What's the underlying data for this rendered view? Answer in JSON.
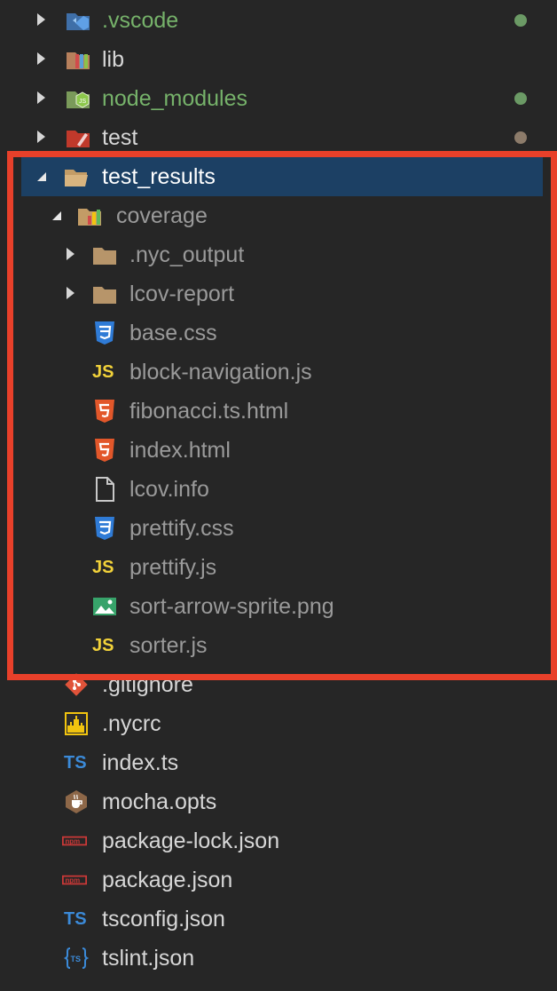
{
  "explorer": {
    "colors": {
      "background": "#262626",
      "selection": "#1c4064",
      "highlight_border": "#e8402a",
      "modified_dot": "#6b9a65",
      "untracked_dot": "#8c7b6a",
      "green_text": "#76b26a",
      "dim_text": "#9a9a9a",
      "light_text": "#d7d7d7"
    },
    "items": [
      {
        "label": ".vscode",
        "icon": "vscode-folder-icon"
      },
      {
        "label": "lib",
        "icon": "lib-folder-icon"
      },
      {
        "label": "node_modules",
        "icon": "node-folder-icon"
      },
      {
        "label": "test",
        "icon": "test-folder-icon"
      },
      {
        "label": "test_results",
        "icon": "folder-open-icon"
      },
      {
        "label": "coverage",
        "icon": "coverage-folder-icon"
      },
      {
        "label": ".nyc_output",
        "icon": "folder-icon"
      },
      {
        "label": "lcov-report",
        "icon": "folder-icon"
      },
      {
        "label": "base.css",
        "icon": "css-icon"
      },
      {
        "label": "block-navigation.js",
        "icon": "js-icon"
      },
      {
        "label": "fibonacci.ts.html",
        "icon": "html-icon"
      },
      {
        "label": "index.html",
        "icon": "html-icon"
      },
      {
        "label": "lcov.info",
        "icon": "file-icon"
      },
      {
        "label": "prettify.css",
        "icon": "css-icon"
      },
      {
        "label": "prettify.js",
        "icon": "js-icon"
      },
      {
        "label": "sort-arrow-sprite.png",
        "icon": "image-icon"
      },
      {
        "label": "sorter.js",
        "icon": "js-icon"
      },
      {
        "label": ".gitignore",
        "icon": "git-icon"
      },
      {
        "label": ".nycrc",
        "icon": "nycrc-icon"
      },
      {
        "label": "index.ts",
        "icon": "typescript-icon"
      },
      {
        "label": "mocha.opts",
        "icon": "mocha-icon"
      },
      {
        "label": "package-lock.json",
        "icon": "npm-icon"
      },
      {
        "label": "package.json",
        "icon": "npm-icon"
      },
      {
        "label": "tsconfig.json",
        "icon": "tsconfig-icon"
      },
      {
        "label": "tslint.json",
        "icon": "tslint-icon"
      }
    ],
    "icon_glyphs": {
      "js": "JS",
      "ts": "TS",
      "npm": "npm"
    }
  }
}
